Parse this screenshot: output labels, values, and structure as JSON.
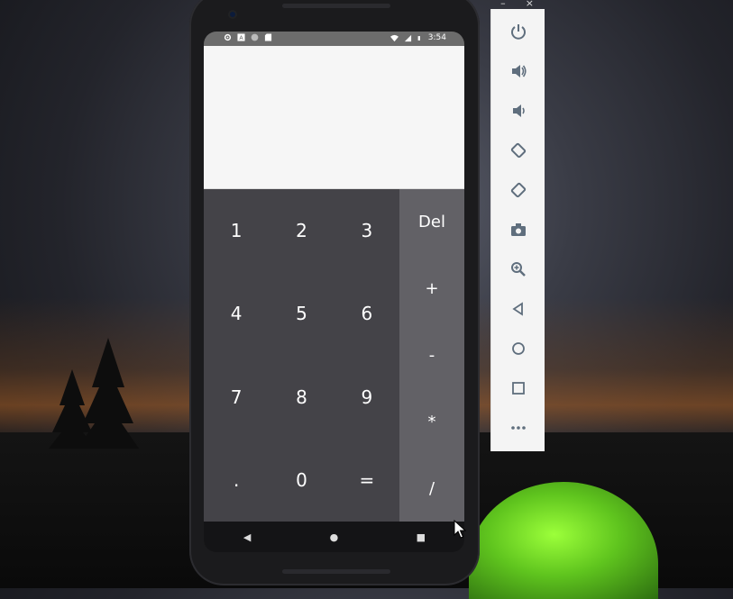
{
  "status_bar": {
    "time": "3:54",
    "icons_left": [
      "settings-icon",
      "a-icon",
      "sync-icon",
      "sd-card-icon"
    ],
    "icons_right": [
      "wifi-icon",
      "signal-icon",
      "battery-icon"
    ]
  },
  "calculator": {
    "display_value": "",
    "keys": [
      "1",
      "2",
      "3",
      "4",
      "5",
      "6",
      "7",
      "8",
      "9",
      ".",
      "0",
      "="
    ],
    "ops": [
      "Del",
      "+",
      "-",
      "*",
      "/"
    ]
  },
  "nav_bar": {
    "buttons": [
      "back-icon",
      "home-icon",
      "recents-icon"
    ]
  },
  "emulator_toolbar": {
    "top": [
      "minimize-icon",
      "close-icon"
    ],
    "buttons": [
      "power-icon",
      "volume-up-icon",
      "volume-down-icon",
      "rotate-left-icon",
      "rotate-right-icon",
      "camera-icon",
      "zoom-icon",
      "back-icon",
      "home-icon",
      "overview-icon",
      "more-icon"
    ]
  },
  "colors": {
    "keypad_bg": "#444348",
    "ops_bg": "#626166",
    "display_bg": "#f6f6f6",
    "toolbar_icon": "#5f6e7d"
  }
}
